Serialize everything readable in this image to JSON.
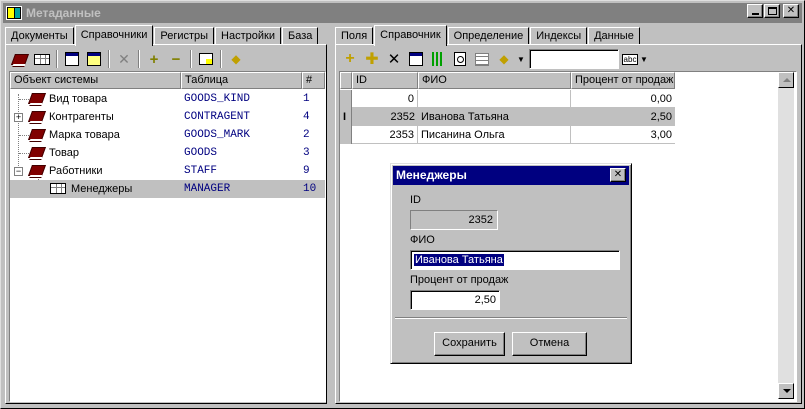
{
  "window": {
    "title": "Метаданные"
  },
  "left": {
    "tabs": [
      "Документы",
      "Справочники",
      "Регистры",
      "Настройки",
      "База"
    ],
    "active_tab": 1,
    "columns": [
      "Объект системы",
      "Таблица",
      "#"
    ],
    "rows": [
      {
        "name": "Вид товара",
        "table": "GOODS_KIND",
        "num": "1"
      },
      {
        "name": "Контрагенты",
        "table": "CONTRAGENT",
        "num": "4"
      },
      {
        "name": "Марка товара",
        "table": "GOODS_MARK",
        "num": "2"
      },
      {
        "name": "Товар",
        "table": "GOODS",
        "num": "3"
      },
      {
        "name": "Работники",
        "table": "STAFF",
        "num": "9"
      },
      {
        "name": "Менеджеры",
        "table": "MANAGER",
        "num": "10"
      }
    ]
  },
  "right": {
    "tabs": [
      "Поля",
      "Справочник",
      "Определение",
      "Индексы",
      "Данные"
    ],
    "active_tab": 1,
    "search_value": "",
    "columns": [
      "ID",
      "ФИО",
      "Процент от продаж"
    ],
    "rows": [
      {
        "id": "0",
        "fio": "",
        "pct": "0,00"
      },
      {
        "id": "2352",
        "fio": "Иванова Татьяна",
        "pct": "2,50"
      },
      {
        "id": "2353",
        "fio": "Писанина Ольга",
        "pct": "3,00"
      }
    ],
    "row_marker": "I"
  },
  "dialog": {
    "title": "Менеджеры",
    "id_label": "ID",
    "id_value": "2352",
    "fio_label": "ФИО",
    "fio_value": "Иванова Татьяна",
    "pct_label": "Процент от продаж",
    "pct_value": "2,50",
    "save": "Сохранить",
    "cancel": "Отмена"
  },
  "colors": {
    "selection": "#000080",
    "highlight_row": "#c0c0c0",
    "code_text": "#000080"
  }
}
